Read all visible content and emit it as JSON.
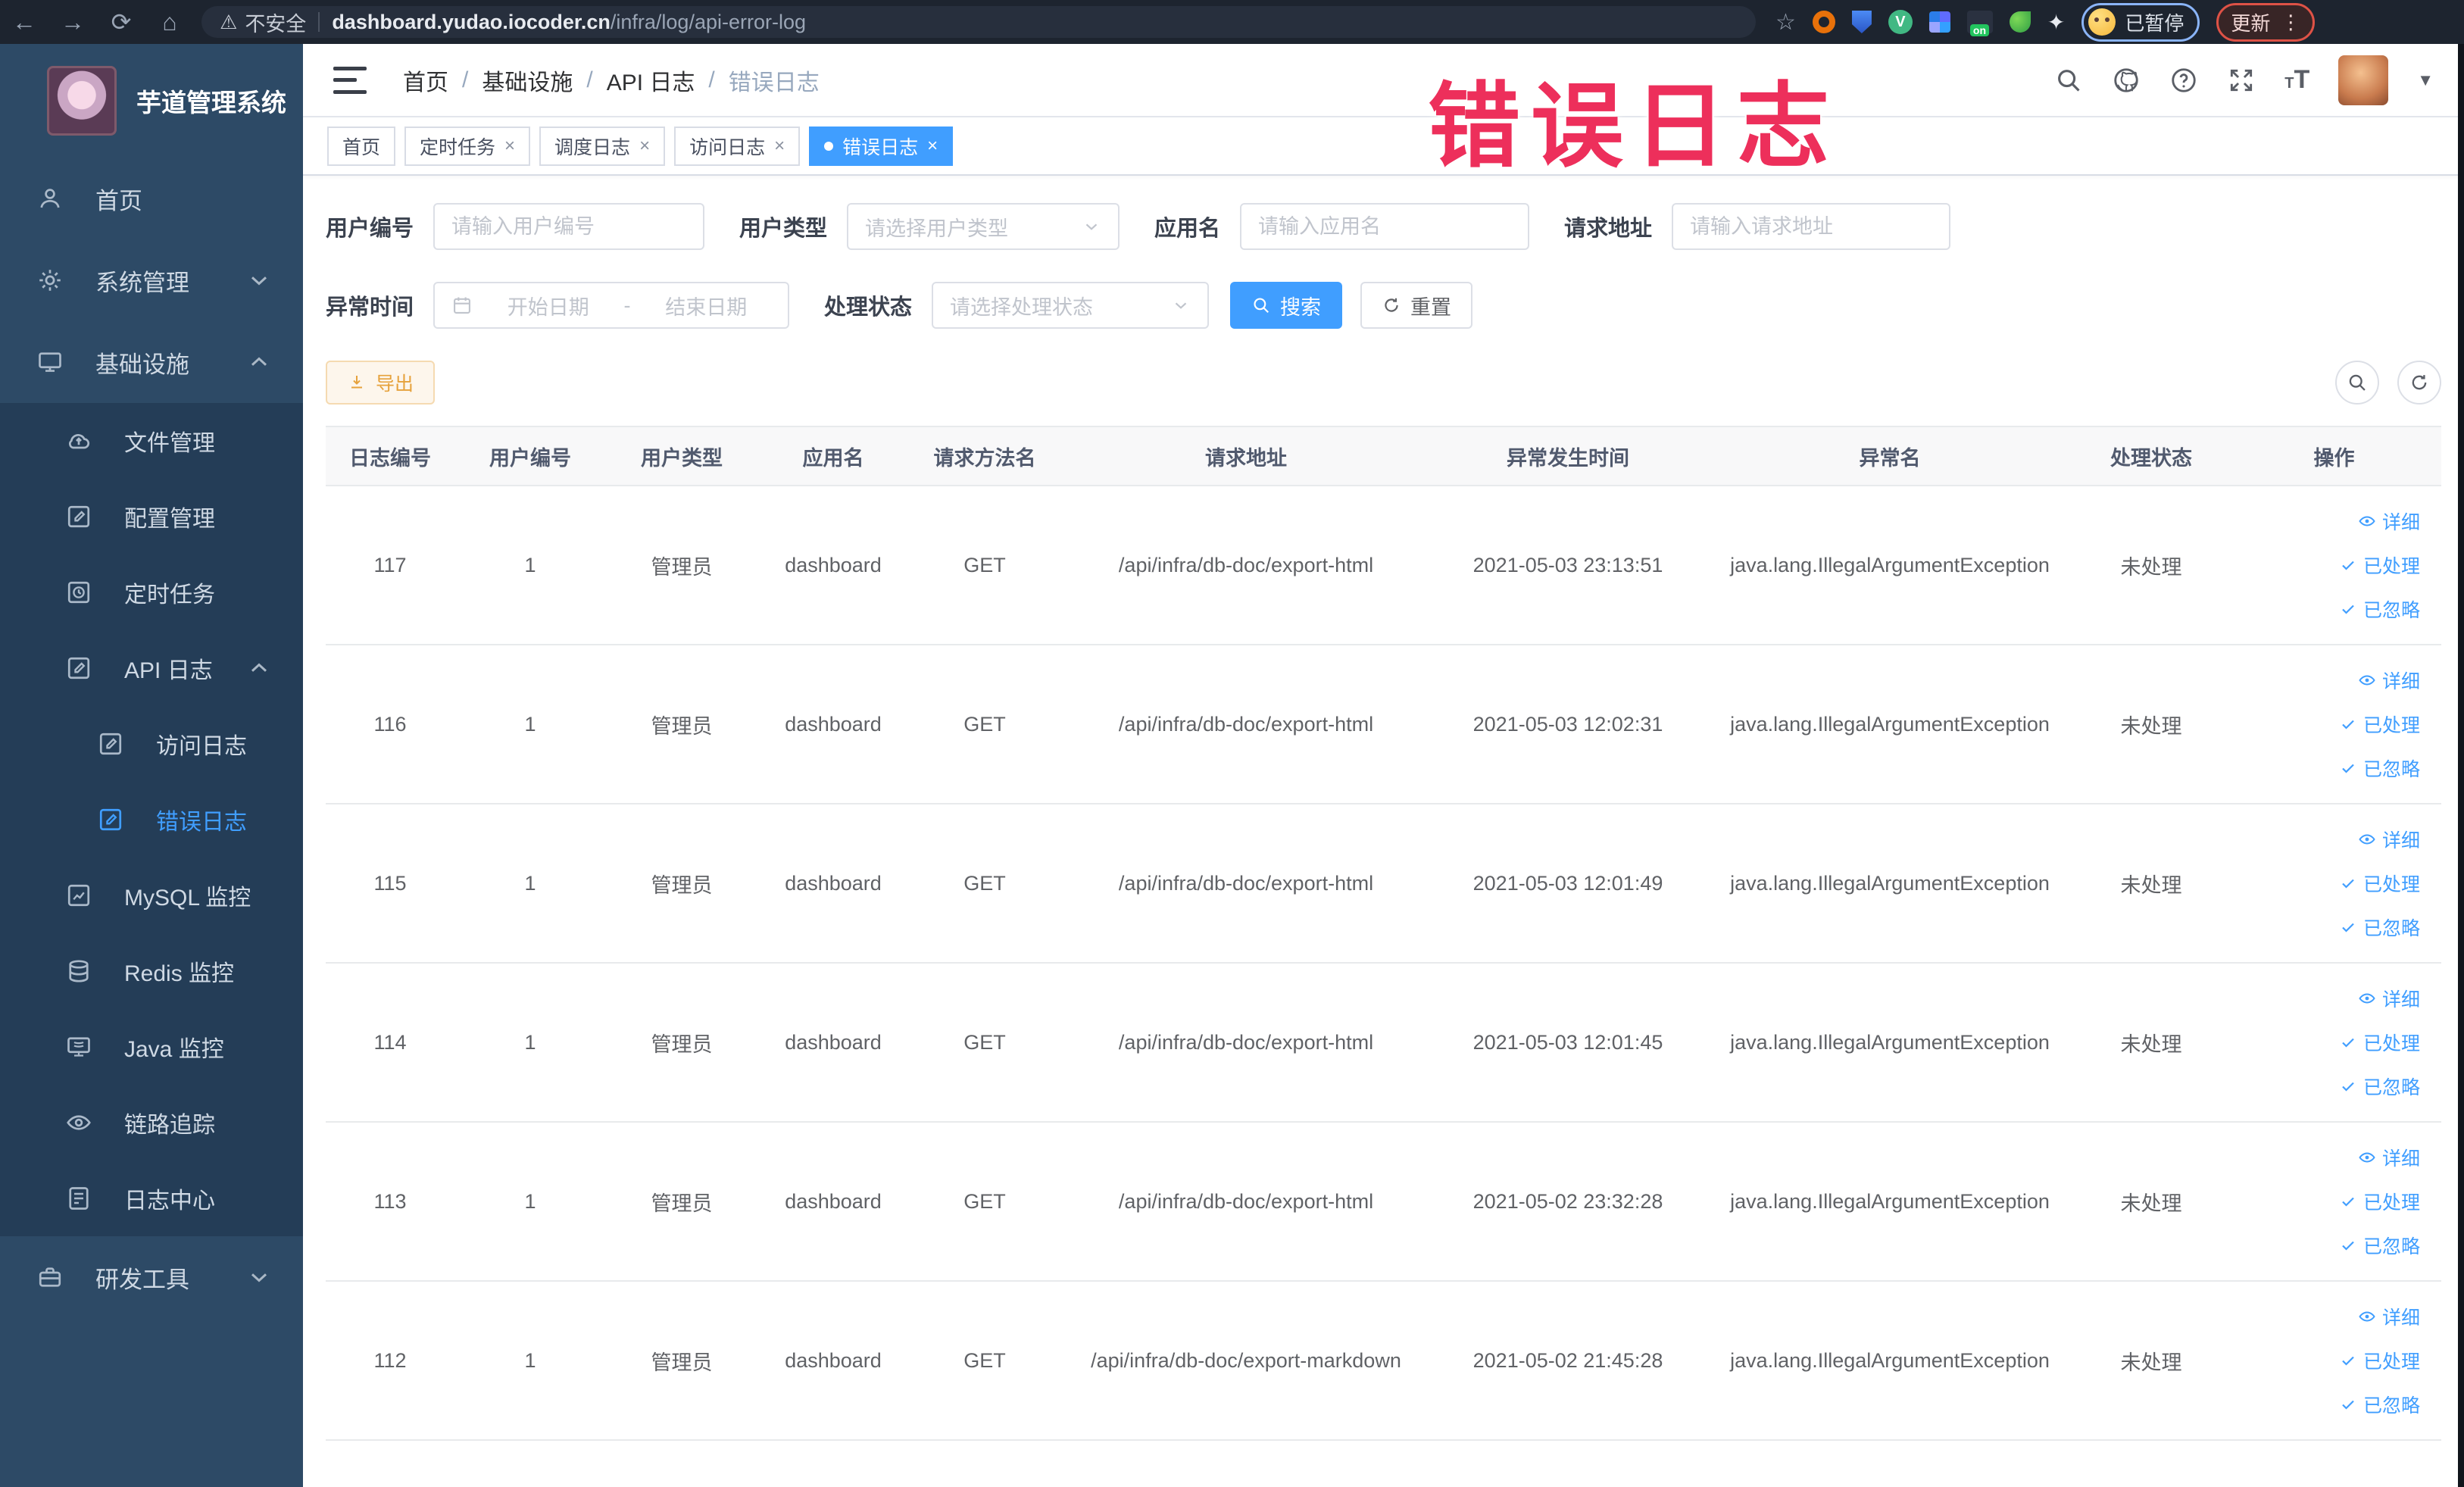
{
  "browser": {
    "security_label": "不安全",
    "url_host": "dashboard.yudao.iocoder.cn",
    "url_path": "/infra/log/api-error-log",
    "profile_status": "已暂停",
    "update_label": "更新"
  },
  "overlay": {
    "text": "错误日志",
    "color": "#ed2f5b"
  },
  "sidebar": {
    "title": "芋道管理系统",
    "items": [
      {
        "label": "首页"
      },
      {
        "label": "系统管理"
      },
      {
        "label": "基础设施"
      },
      {
        "label": "文件管理"
      },
      {
        "label": "配置管理"
      },
      {
        "label": "定时任务"
      },
      {
        "label": "API 日志"
      },
      {
        "label": "访问日志"
      },
      {
        "label": "错误日志"
      },
      {
        "label": "MySQL 监控"
      },
      {
        "label": "Redis 监控"
      },
      {
        "label": "Java 监控"
      },
      {
        "label": "链路追踪"
      },
      {
        "label": "日志中心"
      },
      {
        "label": "研发工具"
      }
    ]
  },
  "header": {
    "breadcrumb": [
      "首页",
      "基础设施",
      "API 日志",
      "错误日志"
    ]
  },
  "tabs": [
    {
      "label": "首页"
    },
    {
      "label": "定时任务"
    },
    {
      "label": "调度日志"
    },
    {
      "label": "访问日志"
    },
    {
      "label": "错误日志"
    }
  ],
  "filters": {
    "user_id": {
      "label": "用户编号",
      "placeholder": "请输入用户编号"
    },
    "user_type": {
      "label": "用户类型",
      "placeholder": "请选择用户类型"
    },
    "app_name": {
      "label": "应用名",
      "placeholder": "请输入应用名"
    },
    "request_url": {
      "label": "请求地址",
      "placeholder": "请输入请求地址"
    },
    "exception_time": {
      "label": "异常时间",
      "start_placeholder": "开始日期",
      "separator": "-",
      "end_placeholder": "结束日期"
    },
    "process_status": {
      "label": "处理状态",
      "placeholder": "请选择处理状态"
    },
    "search_label": "搜索",
    "reset_label": "重置"
  },
  "toolbar": {
    "export_label": "导出"
  },
  "table": {
    "columns": [
      "日志编号",
      "用户编号",
      "用户类型",
      "应用名",
      "请求方法名",
      "请求地址",
      "异常发生时间",
      "异常名",
      "处理状态",
      "操作"
    ],
    "row_actions": [
      "详细",
      "已处理",
      "已忽略"
    ],
    "rows": [
      {
        "id": "117",
        "user_id": "1",
        "user_type": "管理员",
        "app": "dashboard",
        "method": "GET",
        "url": "/api/infra/db-doc/export-html",
        "time": "2021-05-03 23:13:51",
        "exception": "java.lang.IllegalArgumentException",
        "status": "未处理"
      },
      {
        "id": "116",
        "user_id": "1",
        "user_type": "管理员",
        "app": "dashboard",
        "method": "GET",
        "url": "/api/infra/db-doc/export-html",
        "time": "2021-05-03 12:02:31",
        "exception": "java.lang.IllegalArgumentException",
        "status": "未处理"
      },
      {
        "id": "115",
        "user_id": "1",
        "user_type": "管理员",
        "app": "dashboard",
        "method": "GET",
        "url": "/api/infra/db-doc/export-html",
        "time": "2021-05-03 12:01:49",
        "exception": "java.lang.IllegalArgumentException",
        "status": "未处理"
      },
      {
        "id": "114",
        "user_id": "1",
        "user_type": "管理员",
        "app": "dashboard",
        "method": "GET",
        "url": "/api/infra/db-doc/export-html",
        "time": "2021-05-03 12:01:45",
        "exception": "java.lang.IllegalArgumentException",
        "status": "未处理"
      },
      {
        "id": "113",
        "user_id": "1",
        "user_type": "管理员",
        "app": "dashboard",
        "method": "GET",
        "url": "/api/infra/db-doc/export-html",
        "time": "2021-05-02 23:32:28",
        "exception": "java.lang.IllegalArgumentException",
        "status": "未处理"
      },
      {
        "id": "112",
        "user_id": "1",
        "user_type": "管理员",
        "app": "dashboard",
        "method": "GET",
        "url": "/api/infra/db-doc/export-markdown",
        "time": "2021-05-02 21:45:28",
        "exception": "java.lang.IllegalArgumentException",
        "status": "未处理"
      }
    ]
  },
  "colors": {
    "primary": "#409eff",
    "warning": "#e6a23c",
    "sidebar_bg": "#2d4a66",
    "submenu_bg": "#243d57",
    "chrome_bg": "#1d242f",
    "stamp": "#ed2f5b"
  }
}
